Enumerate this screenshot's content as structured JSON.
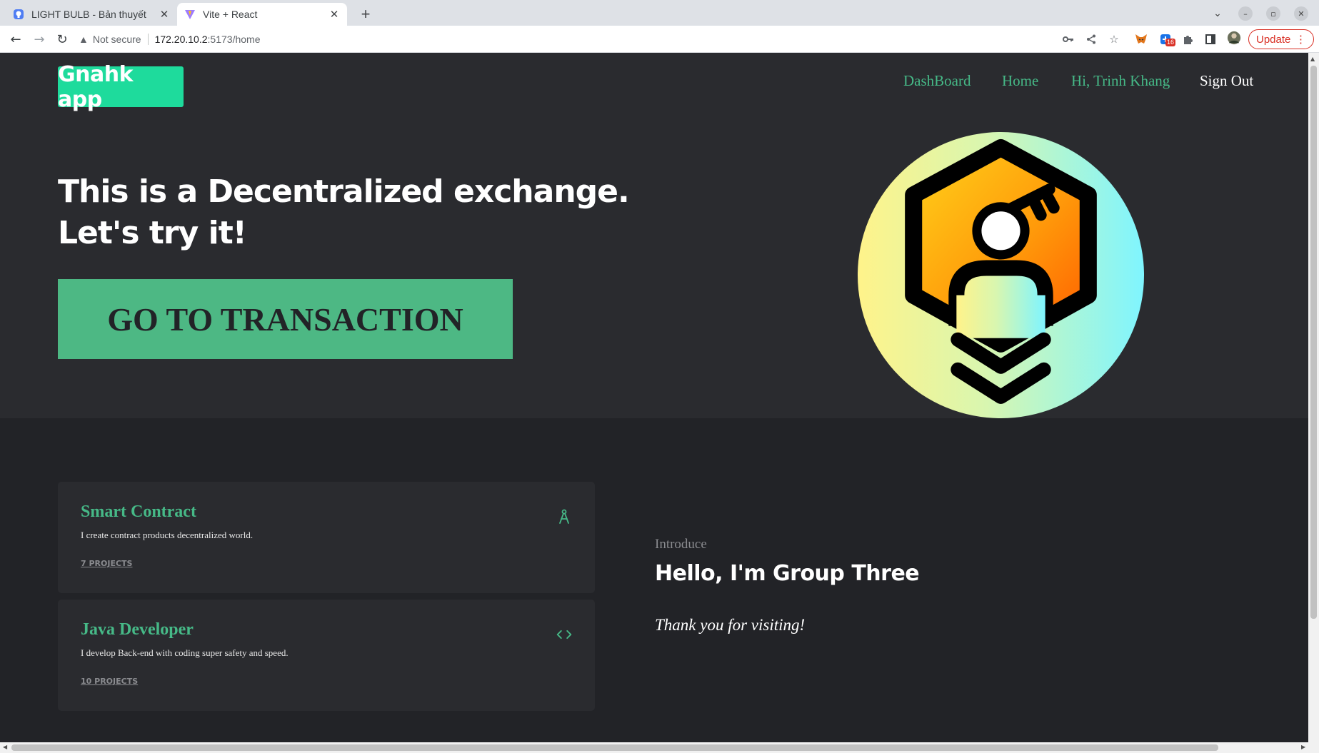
{
  "browser": {
    "tabs": [
      {
        "title": "LIGHT BULB - Bản thuyết",
        "favicon": "lightbulb-app-icon",
        "active": false
      },
      {
        "title": "Vite + React",
        "favicon": "vite-logo-icon",
        "active": true
      }
    ],
    "close_glyph": "✕",
    "new_tab_glyph": "+",
    "security_label": "Not secure",
    "url_host": "172.20.10.2",
    "url_path": ":5173/home",
    "update_label": "Update",
    "extension_badge": "16",
    "colors": {
      "tabstrip": "#dee1e6",
      "update": "#d93025"
    }
  },
  "page": {
    "logo_text": "Gnahk app",
    "nav": {
      "dashboard": "DashBoard",
      "home": "Home",
      "greeting": "Hi, Trinh Khang",
      "signout": "Sign Out"
    },
    "hero": {
      "headline_line1": "This is a Decentralized exchange.",
      "headline_line2": "Let's try it!",
      "cta_label": "GO TO TRANSACTION",
      "illustration": "hexagon-user-key-icon"
    },
    "cards": [
      {
        "title": "Smart Contract",
        "description": "I create contract products decentralized world.",
        "link": "7 PROJECTS",
        "icon": "compass-icon"
      },
      {
        "title": "Java Developer",
        "description": "I develop Back-end with coding super safety and speed.",
        "link": "10 PROJECTS",
        "icon": "code-brackets-icon"
      }
    ],
    "intro": {
      "kicker": "Introduce",
      "title": "Hello, I'm Group Three",
      "thanks": "Thank you for visiting!"
    },
    "colors": {
      "accent": "#46b987",
      "logo_bg": "#1edb9c",
      "cta_bg": "#4db884",
      "hero_bg": "#2a2b2f",
      "lower_bg": "#222327"
    }
  }
}
